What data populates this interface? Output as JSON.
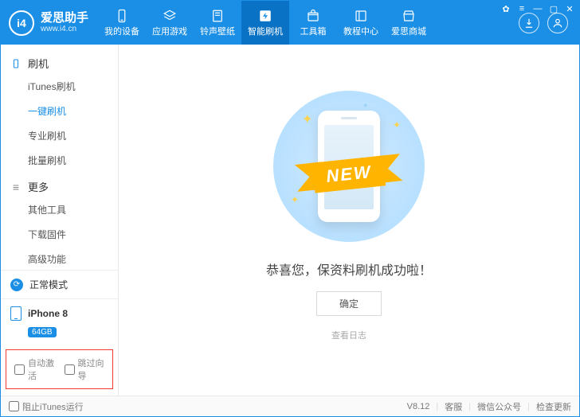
{
  "brand": {
    "name": "爱思助手",
    "url": "www.i4.cn",
    "logo_text": "i4"
  },
  "sys": {
    "skin": "✿",
    "menu": "≡",
    "min": "—",
    "max": "▢",
    "close": "✕"
  },
  "nav": [
    {
      "label": "我的设备",
      "icon": "phone"
    },
    {
      "label": "应用游戏",
      "icon": "apps"
    },
    {
      "label": "铃声壁纸",
      "icon": "note"
    },
    {
      "label": "智能刷机",
      "icon": "flash",
      "active": true
    },
    {
      "label": "工具箱",
      "icon": "box"
    },
    {
      "label": "教程中心",
      "icon": "book"
    },
    {
      "label": "爱思商城",
      "icon": "shop"
    }
  ],
  "sidebar": {
    "groups": [
      {
        "title": "刷机",
        "icon": "phone",
        "items": [
          {
            "label": "iTunes刷机"
          },
          {
            "label": "一键刷机",
            "active": true
          },
          {
            "label": "专业刷机"
          },
          {
            "label": "批量刷机"
          }
        ]
      },
      {
        "title": "更多",
        "icon": "more",
        "items": [
          {
            "label": "其他工具"
          },
          {
            "label": "下载固件"
          },
          {
            "label": "高级功能"
          }
        ]
      }
    ],
    "mode": "正常模式",
    "device": {
      "name": "iPhone 8",
      "storage": "64GB"
    },
    "options": {
      "auto_activate": "自动激活",
      "skip_guide": "跳过向导"
    }
  },
  "main": {
    "ribbon": "NEW",
    "success": "恭喜您，保资料刷机成功啦！",
    "ok": "确定",
    "view_log": "查看日志"
  },
  "footer": {
    "block_itunes": "阻止iTunes运行",
    "version": "V8.12",
    "support": "客服",
    "wechat": "微信公众号",
    "check_update": "检查更新"
  }
}
